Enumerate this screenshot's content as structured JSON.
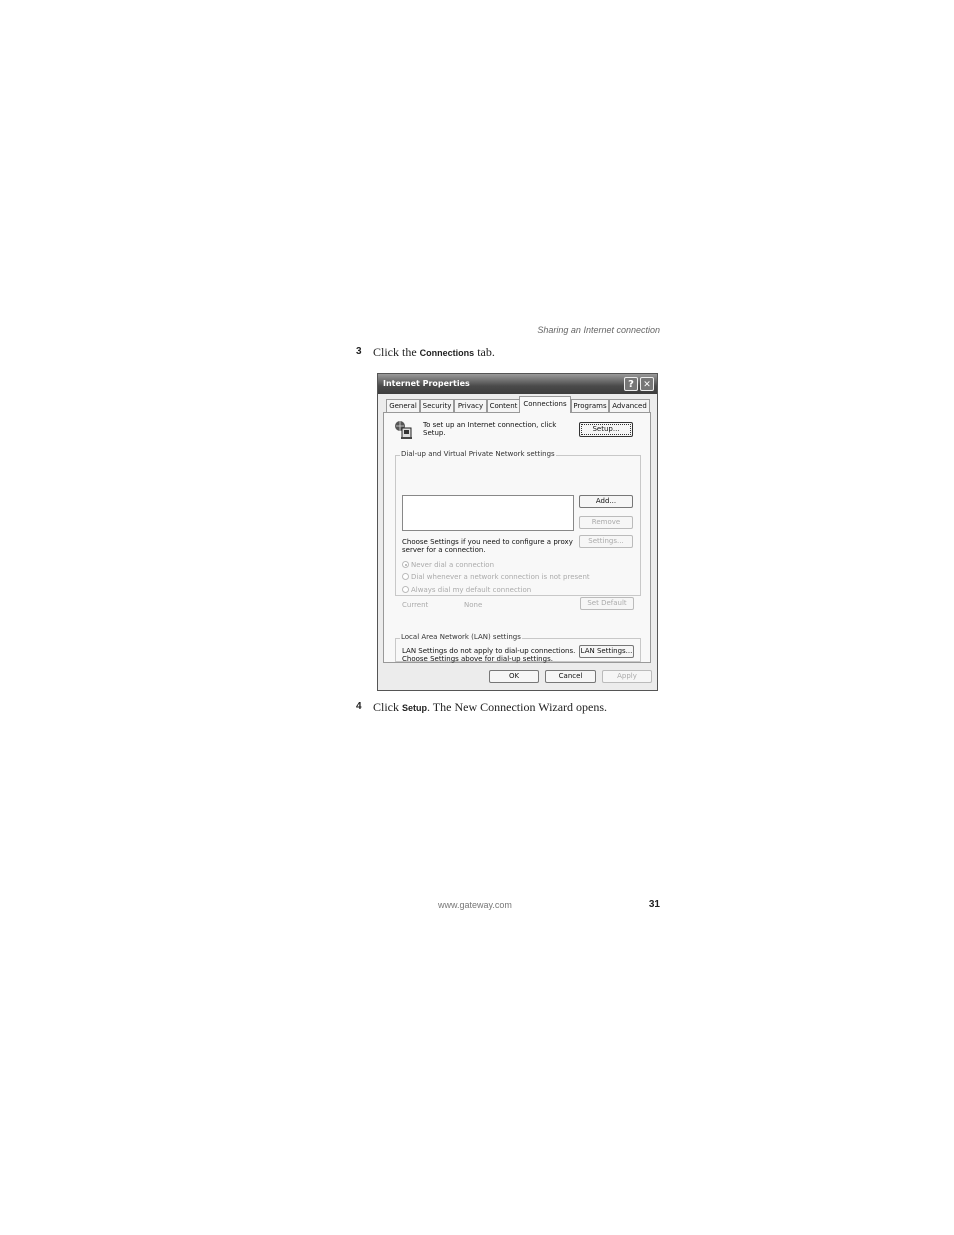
{
  "header": {
    "section": "Sharing an Internet connection"
  },
  "steps": [
    {
      "number": "3",
      "before": "Click the ",
      "ui": "Connections",
      "after": " tab."
    },
    {
      "number": "4",
      "before": "Click ",
      "ui": "Setup",
      "after": ". The New Connection Wizard opens."
    }
  ],
  "dialog": {
    "title": "Internet Properties",
    "help_glyph": "?",
    "close_glyph": "✕",
    "tabs": [
      "General",
      "Security",
      "Privacy",
      "Content",
      "Connections",
      "Programs",
      "Advanced"
    ],
    "active_tab": "Connections",
    "intro_text_1": "To set up an Internet connection, click",
    "intro_text_2": "Setup.",
    "setup_button": "Setup...",
    "dialup_group_label": "Dial-up and Virtual Private Network settings",
    "add_button": "Add...",
    "remove_button": "Remove",
    "settings_text_1": "Choose Settings if you need to configure a proxy",
    "settings_text_2": "server for a connection.",
    "settings_button": "Settings...",
    "radio_options": [
      {
        "label": "Never dial a connection",
        "selected": true
      },
      {
        "label": "Dial whenever a network connection is not present",
        "selected": false
      },
      {
        "label": "Always dial my default connection",
        "selected": false
      }
    ],
    "current_label": "Current",
    "current_value": "None",
    "set_default_button": "Set Default",
    "lan_group_label": "Local Area Network (LAN) settings",
    "lan_text_1": "LAN Settings do not apply to dial-up connections.",
    "lan_text_2": "Choose Settings above for dial-up settings.",
    "lan_settings_button": "LAN Settings...",
    "ok_button": "OK",
    "cancel_button": "Cancel",
    "apply_button": "Apply"
  },
  "footer": {
    "url": "www.gateway.com",
    "page_number": "31"
  }
}
